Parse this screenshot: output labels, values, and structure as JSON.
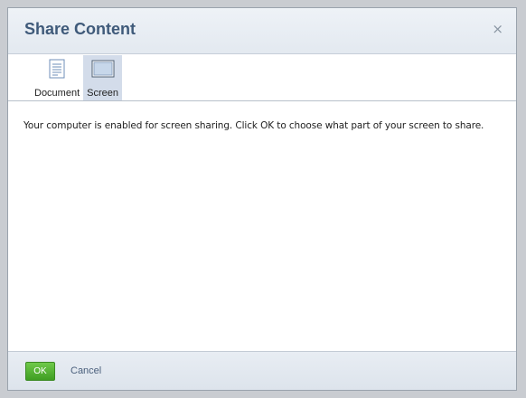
{
  "dialog": {
    "title": "Share Content",
    "close_glyph": "×",
    "close_icon": "close-icon"
  },
  "toolbar": {
    "items": [
      {
        "label": "Document",
        "icon": "document-icon",
        "active": false
      },
      {
        "label": "Screen",
        "icon": "screen-icon",
        "active": true
      }
    ]
  },
  "content": {
    "message": "Your computer is enabled for screen sharing. Click OK to choose what part of your screen to share."
  },
  "footer": {
    "ok_label": "OK",
    "cancel_label": "Cancel"
  },
  "colors": {
    "title": "#3f5a7a",
    "ok_button": "#4caf2c",
    "active_tab": "#d3dcea",
    "cancel_link": "#4a5f7c"
  }
}
